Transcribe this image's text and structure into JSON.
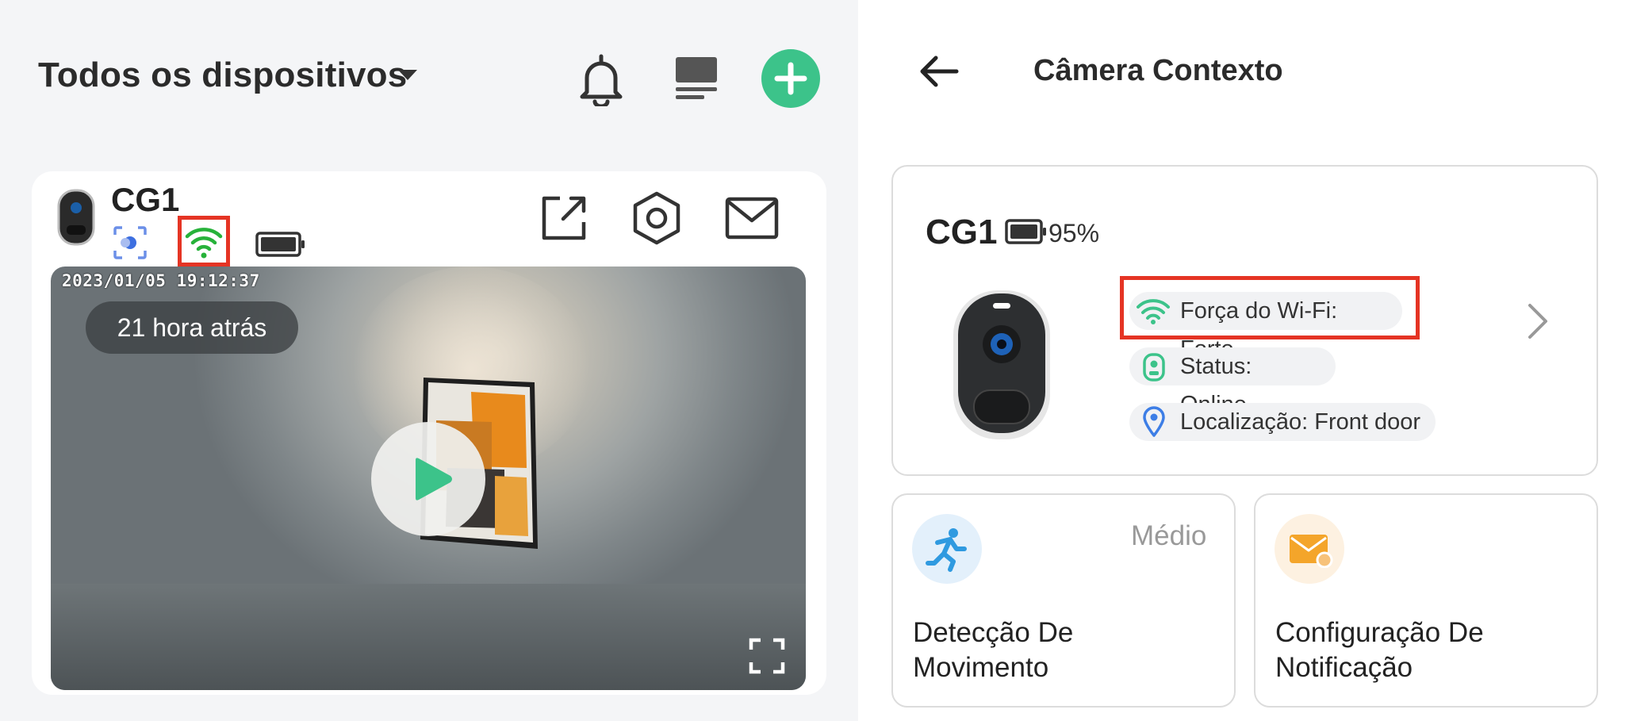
{
  "left": {
    "header": {
      "title": "Todos os dispositivos"
    },
    "device": {
      "name": "CG1",
      "timestamp": "2023/01/05  19:12:37",
      "time_ago": "21 hora atrás"
    }
  },
  "right": {
    "header": {
      "title": "Câmera Contexto"
    },
    "device": {
      "name": "CG1",
      "battery": "95%",
      "wifi": "Força do Wi-Fi: Forte",
      "status": "Status: Online",
      "location": "Localização: Front door"
    },
    "tiles": [
      {
        "title_line1": "Detecção De",
        "title_line2": "Movimento",
        "badge": "Médio"
      },
      {
        "title_line1": "Configuração De",
        "title_line2": "Notificação"
      }
    ]
  },
  "colors": {
    "accent_green": "#3cc38a",
    "highlight_red": "#e53424",
    "wifi_green": "#27b23a",
    "location_blue": "#3d7ee6"
  },
  "icons": [
    "caret-down-icon",
    "bell-icon",
    "multiview-icon",
    "add-icon",
    "camera-thumb-icon",
    "face-detect-icon",
    "wifi-icon",
    "battery-icon",
    "share-icon",
    "settings-icon",
    "mail-icon",
    "play-icon",
    "fullscreen-icon",
    "back-arrow-icon",
    "chevron-right-icon",
    "status-icon",
    "location-icon",
    "motion-icon",
    "notification-icon"
  ]
}
